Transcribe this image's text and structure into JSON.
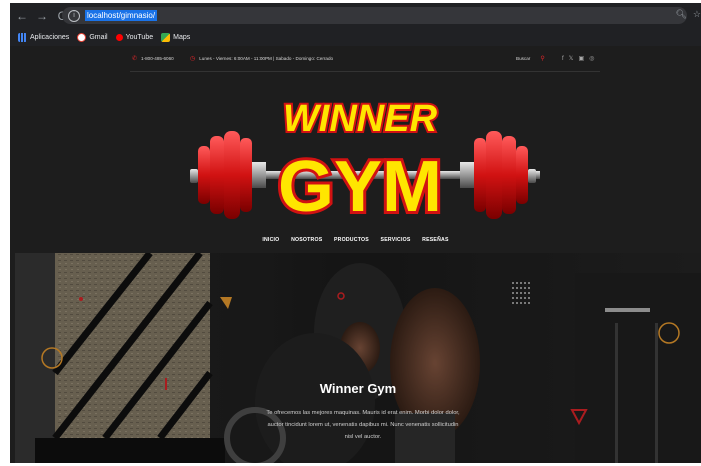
{
  "browser": {
    "url": "localhost/gimnasio/",
    "bookmarks": [
      {
        "label": "Aplicaciones",
        "icon": "apps-grid-icon",
        "color": "#4285f4"
      },
      {
        "label": "Gmail",
        "icon": "gmail-icon",
        "color": "#ea4335"
      },
      {
        "label": "YouTube",
        "icon": "youtube-icon",
        "color": "#ff0000"
      },
      {
        "label": "Maps",
        "icon": "maps-icon",
        "color": "#34a853"
      }
    ]
  },
  "site": {
    "phone": "1-800-485-6060",
    "hours": "Lunes - Viernes: 6:00AM - 11:00PM | Sabado - Domingo: Cerrado",
    "search_label": "Buscar",
    "social": [
      "f",
      "𝕏",
      "▣",
      "◎"
    ],
    "logo": {
      "line1": "WINNER",
      "line2": "GYM"
    },
    "menu": [
      "INICIO",
      "NOSOTROS",
      "PRODUCTOS",
      "SERVICIOS",
      "RESEÑAS"
    ],
    "hero": {
      "title": "Winner Gym",
      "line1": "Te ofrecemos las mejores maquinas. Mauris id erat enim. Morbi dolor dolor,",
      "line2": "auctor tincidunt lorem ut, venenatis dapibus mi. Nunc venenatis sollicitudin",
      "line3": "nisl vel auctor."
    }
  },
  "colors": {
    "accent_red": "#e3262a",
    "logo_yellow": "#ffe600",
    "accent_orange": "#f0a030"
  }
}
